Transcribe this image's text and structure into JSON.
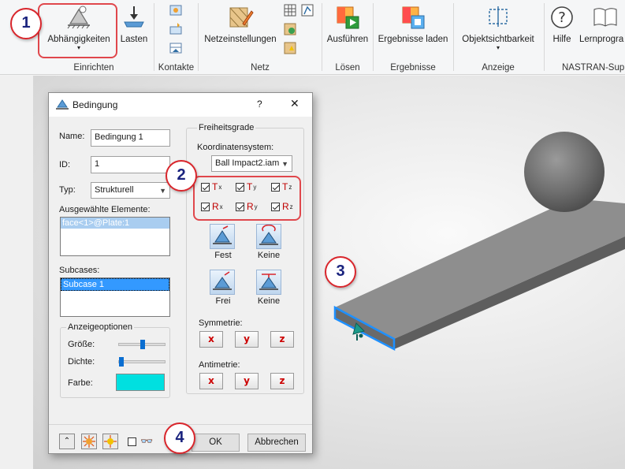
{
  "ribbon": {
    "buttons": {
      "constraints": "Abhängigkeiten",
      "loads": "Lasten",
      "mesh_settings": "Netzeinstellungen",
      "run": "Ausführen",
      "load_results": "Ergebnisse laden",
      "object_visibility": "Objektsichtbarkeit",
      "help": "Hilfe",
      "learning": "Lernprogra"
    },
    "groups": {
      "setup": "Einrichten",
      "contacts": "Kontakte",
      "mesh": "Netz",
      "solve": "Lösen",
      "results": "Ergebnisse",
      "display": "Anzeige",
      "nastran": "NASTRAN-Sup"
    }
  },
  "dialog": {
    "title": "Bedingung",
    "help_btn": "?",
    "close_btn": "✕",
    "name_label": "Name:",
    "name_value": "Bedingung 1",
    "id_label": "ID:",
    "id_value": "1",
    "type_label": "Typ:",
    "type_value": "Strukturell",
    "selected_label": "Ausgewählte Elemente:",
    "selected_items": [
      "face<1>@Plate:1"
    ],
    "subcases_label": "Subcases:",
    "subcases_items": [
      "Subcase 1"
    ],
    "display_options": {
      "title": "Anzeigeoptionen",
      "size_label": "Größe:",
      "size_level": 0.5,
      "density_label": "Dichte:",
      "density_level": 0.0,
      "color_label": "Farbe:",
      "color": "#00e0e0"
    },
    "dof": {
      "title": "Freiheitsgrade",
      "coord_label": "Koordinatensystem:",
      "coord_value": "Ball Impact2.iam",
      "t_letter": "T",
      "r_letter": "R",
      "sub_x": "x",
      "sub_y": "y",
      "sub_z": "z",
      "fixed_label": "Fest",
      "none_label": "Keine",
      "free_label": "Frei",
      "none2_label": "Keine",
      "symmetry_label": "Symmetrie:",
      "antisymmetry_label": "Antimetrie:",
      "x_btn": "x",
      "y_btn": "y",
      "z_btn": "z"
    },
    "ok": "OK",
    "cancel": "Abbrechen"
  },
  "callouts": [
    "1",
    "2",
    "3",
    "4"
  ],
  "colors": {
    "accent_red": "#d9262c",
    "callout_text": "#1a237e",
    "selection_blue": "#3399ff",
    "edge_highlight": "#1e90ff"
  }
}
